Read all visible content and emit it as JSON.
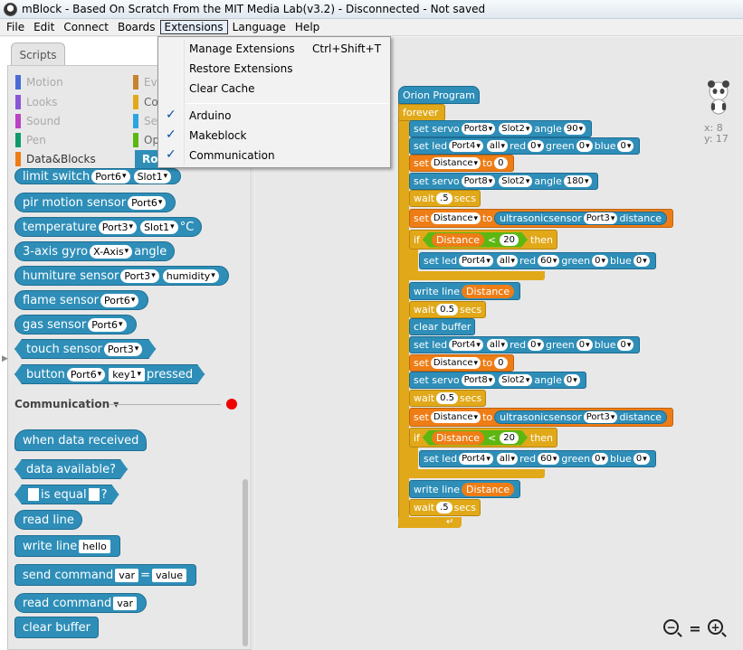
{
  "window": {
    "title": "mBlock - Based On Scratch From the MIT Media Lab(v3.2) - Disconnected - Not saved"
  },
  "menubar": {
    "items": [
      "File",
      "Edit",
      "Connect",
      "Boards",
      "Extensions",
      "Language",
      "Help"
    ],
    "active": "Extensions"
  },
  "extensions_menu": {
    "manage": "Manage Extensions",
    "manage_shortcut": "Ctrl+Shift+T",
    "restore": "Restore Extensions",
    "clear_cache": "Clear Cache",
    "ext_items": [
      {
        "label": "Arduino",
        "checked": true
      },
      {
        "label": "Makeblock",
        "checked": true
      },
      {
        "label": "Communication",
        "checked": true
      }
    ]
  },
  "palette": {
    "tab_label": "Scripts",
    "categories_left": [
      {
        "label": "Motion",
        "color": "#4a6cd4"
      },
      {
        "label": "Looks",
        "color": "#8a55d7"
      },
      {
        "label": "Sound",
        "color": "#bb42c3"
      },
      {
        "label": "Pen",
        "color": "#0e9a6c"
      },
      {
        "label": "Data&Blocks",
        "color": "#ee7d16"
      }
    ],
    "categories_right": [
      {
        "label": "Ev",
        "color": "#c88330"
      },
      {
        "label": "Co",
        "color": "#e1a91a"
      },
      {
        "label": "Se",
        "color": "#2ca5e2"
      },
      {
        "label": "Op",
        "color": "#5cb712"
      },
      {
        "label": "Ro",
        "color": "#2e8eb8"
      }
    ],
    "blocks": {
      "limit_switch": {
        "label": "limit switch",
        "port": "Port6",
        "slot": "Slot1"
      },
      "pir": {
        "label": "pir motion sensor",
        "port": "Port6"
      },
      "temperature": {
        "label": "temperature",
        "port": "Port3",
        "slot": "Slot1",
        "unit": "°C"
      },
      "gyro": {
        "label": "3-axis gyro",
        "axis": "X-Axis",
        "suffix": "angle"
      },
      "humiture": {
        "label": "humiture sensor",
        "port": "Port3",
        "type": "humidity"
      },
      "flame": {
        "label": "flame sensor",
        "port": "Port6"
      },
      "gas": {
        "label": "gas sensor",
        "port": "Port6"
      },
      "touch": {
        "label": "touch sensor",
        "port": "Port3"
      },
      "button": {
        "label": "button",
        "port": "Port6",
        "key": "key1",
        "suffix": "pressed"
      }
    },
    "communication": {
      "header": "Communication",
      "when_data_received": "when data received",
      "data_available": "data available?",
      "is_equal": "is equal",
      "is_equal_q": "?",
      "read_line": "read line",
      "write_line": "write line",
      "write_line_value": "hello",
      "send_command": "send command",
      "send_var": "var",
      "send_eq": "=",
      "send_value": "value",
      "read_command": "read command",
      "read_var": "var",
      "clear_buffer": "clear buffer"
    }
  },
  "script": {
    "hat": "Orion Program",
    "forever": "forever",
    "set_servo": "set servo",
    "angle": "angle",
    "set_led": "set led",
    "red": "red",
    "green": "green",
    "blue": "blue",
    "set": "set",
    "to": "to",
    "wait": "wait",
    "secs": "secs",
    "if": "if",
    "then": "then",
    "write_line": "write line",
    "clear_buffer": "clear buffer",
    "ultrasonic": "ultrasonicsensor",
    "distance_word": "distance",
    "distance_var": "Distance",
    "lt": "<",
    "port8": "Port8",
    "port4": "Port4",
    "port3": "Port3",
    "slot2": "Slot2",
    "all": "all",
    "v90": "90",
    "v0": "0",
    "v180": "180",
    "v60": "60",
    "v20": "20",
    "w05a": ".5",
    "w05b": "0.5",
    "w05c": "0.5",
    "w05d": ".5"
  },
  "sprite": {
    "x_label": "x:",
    "x": "8",
    "y_label": "y:",
    "y": "17"
  },
  "zoom": {
    "out": "−",
    "reset": "=",
    "in": "+"
  }
}
